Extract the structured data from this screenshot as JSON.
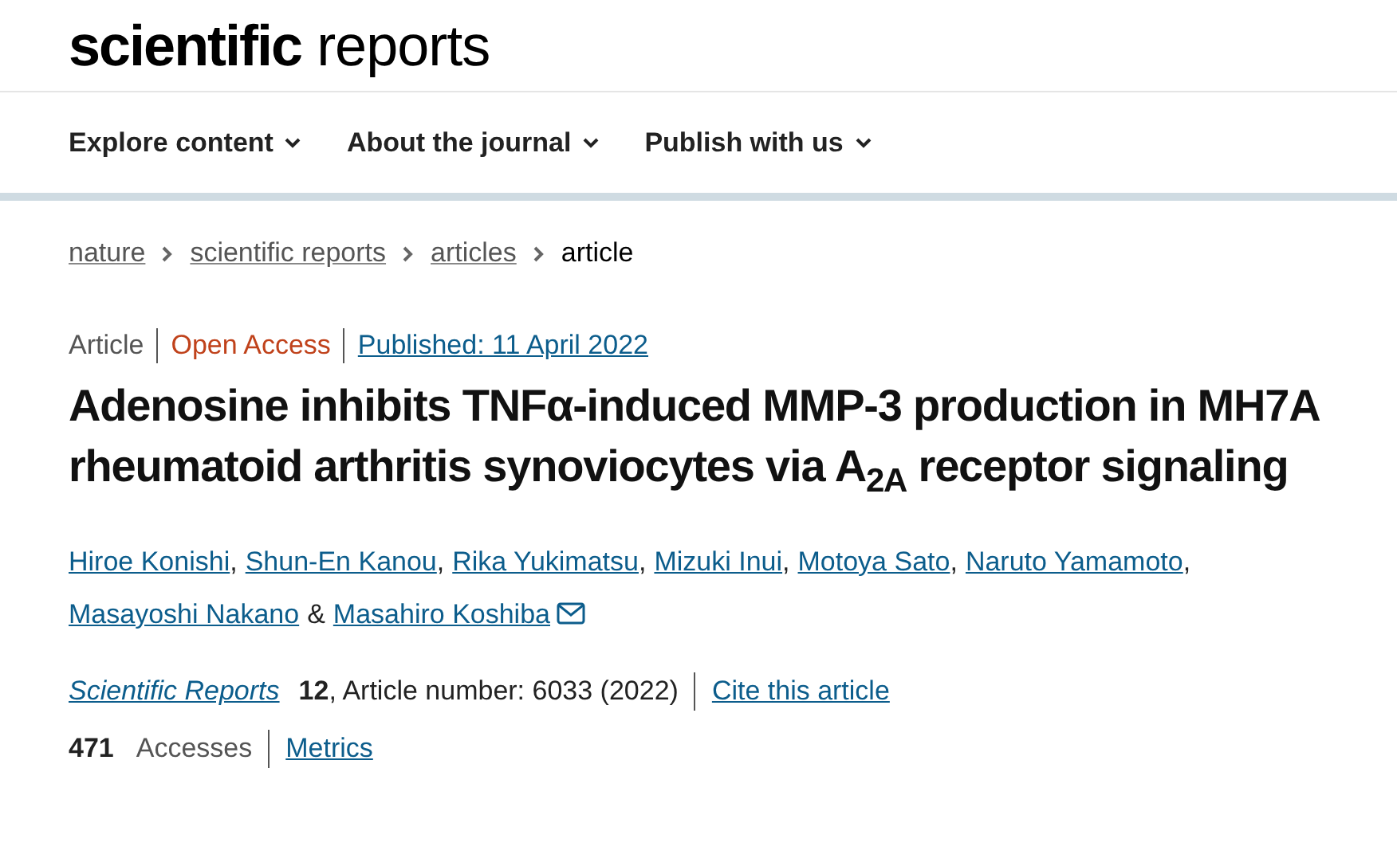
{
  "logo": "**scientific** reports",
  "nav": [
    {
      "label": "Explore content"
    },
    {
      "label": "About the journal"
    },
    {
      "label": "Publish with us"
    }
  ],
  "breadcrumbs": [
    {
      "label": "nature",
      "kind": "link"
    },
    {
      "label": "scientific reports",
      "kind": "link"
    },
    {
      "label": "articles",
      "kind": "link"
    },
    {
      "label": "article",
      "kind": "current"
    }
  ],
  "article_info": {
    "type": "Article",
    "access": "Open Access",
    "published": "Published: 11 April 2022"
  },
  "title": "Adenosine inhibits TNFα-induced MMP-3 production in MH7A rheumatoid arthritis synoviocytes via A$_{2A}$ receptor signaling",
  "authors": [
    {
      "name": "Hiroe Konishi",
      "sep": ","
    },
    {
      "name": "Shun-En Kanou",
      "sep": ","
    },
    {
      "name": "Rika Yukimatsu",
      "sep": ","
    },
    {
      "name": "Mizuki Inui",
      "sep": ","
    },
    {
      "name": "Motoya Sato",
      "sep": ","
    },
    {
      "name": "Naruto Yamamoto",
      "sep": ","
    },
    {
      "name": "Masayoshi Nakano",
      "sep": "&"
    },
    {
      "name": "Masahiro Koshiba",
      "email": true
    }
  ],
  "citation": {
    "journal": "Scientific Reports",
    "details": "**12**, Article number: 6033 (2022)",
    "cite_link": "Cite this article"
  },
  "metrics": {
    "count": "471",
    "label": "Accesses",
    "link": "Metrics"
  }
}
